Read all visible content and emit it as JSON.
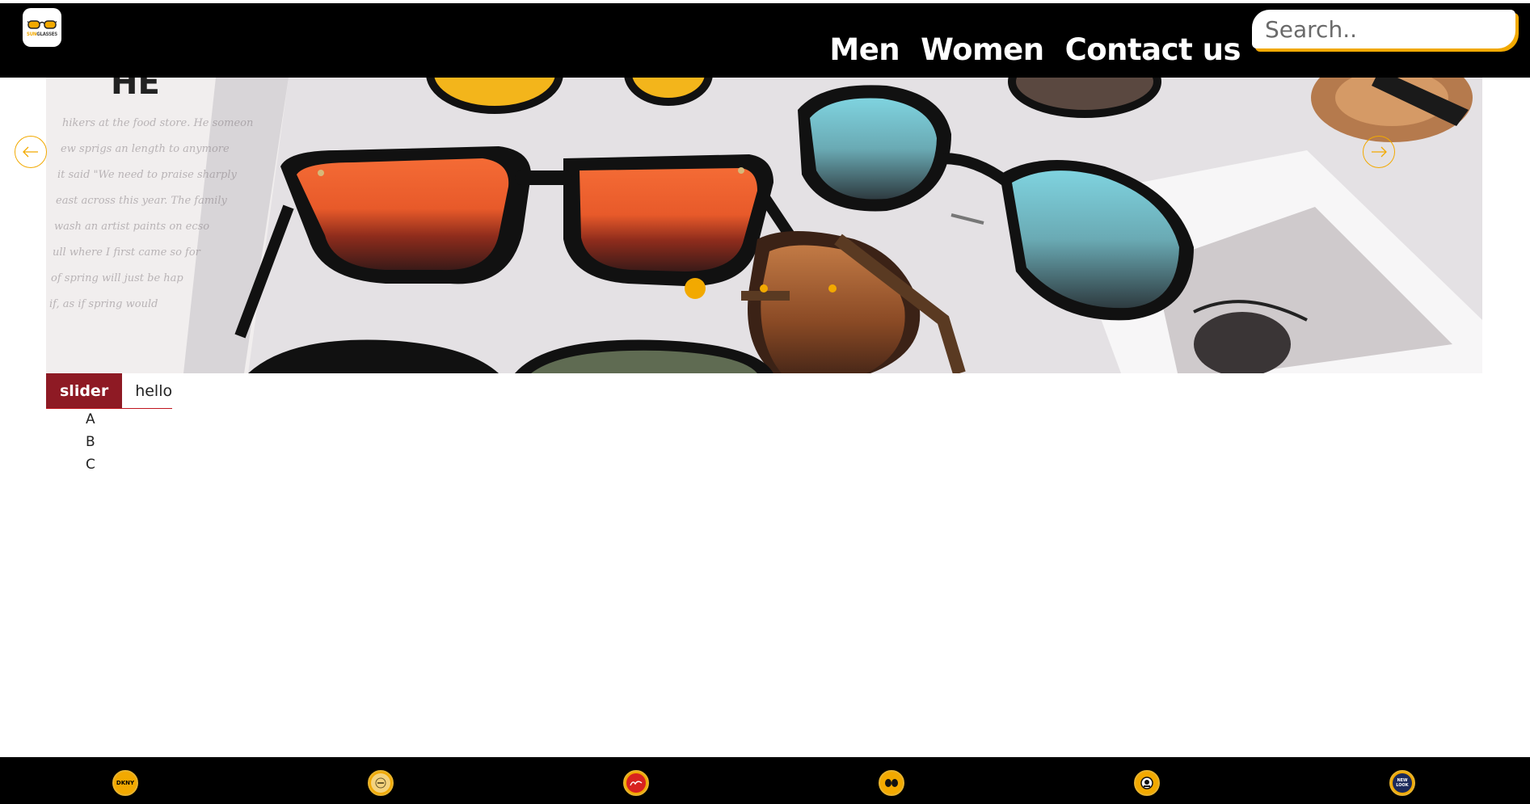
{
  "header": {
    "logo_text_sun": "SUN",
    "logo_text_glasses": "GLASSES",
    "nav": [
      {
        "label": "Men"
      },
      {
        "label": "Women"
      },
      {
        "label": "Contact us"
      }
    ],
    "search_placeholder": "Search.."
  },
  "slider": {
    "slide_count": 3,
    "active_slide": 1,
    "accent_color": "#f2a900",
    "prev_icon": "arrow-left-icon",
    "next_icon": "arrow-right-icon"
  },
  "tabs": [
    {
      "label": "slider",
      "active": true
    },
    {
      "label": "hello",
      "active": false
    }
  ],
  "list_items": [
    "A",
    "B",
    "C"
  ],
  "footer": {
    "brands": [
      {
        "name": "dkny-logo-icon",
        "text": "DKNY"
      },
      {
        "name": "prada-logo-icon",
        "text": ""
      },
      {
        "name": "rayban-logo-icon",
        "text": ""
      },
      {
        "name": "oakley-logo-icon",
        "text": ""
      },
      {
        "name": "gucci-logo-icon",
        "text": ""
      },
      {
        "name": "newlook-logo-icon",
        "text": "NEW LOOK"
      }
    ]
  },
  "colors": {
    "header_bg": "#000000",
    "accent": "#f2a900",
    "tab_active": "#8e1a24",
    "tab_border": "#c0151f"
  }
}
